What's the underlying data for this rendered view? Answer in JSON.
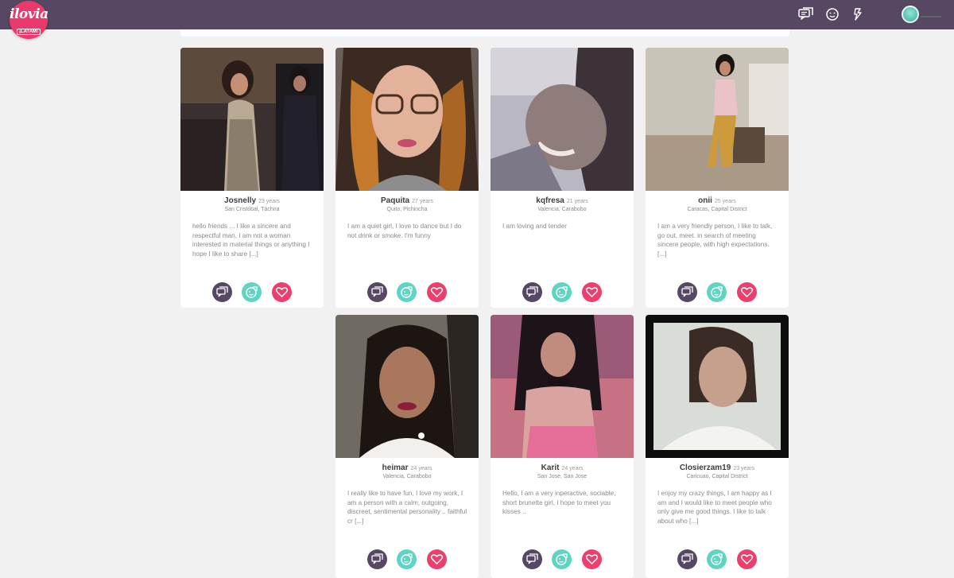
{
  "header": {
    "logo_text": "ilovia",
    "logo_tag": "¡LATAM!",
    "icons": [
      "messages-icon",
      "smiley-icon",
      "flash-icon"
    ]
  },
  "colors": {
    "header_bg": "#564863",
    "brand_pink": "#ea3a6d",
    "chat_button": "#564863",
    "wink_button": "#5fd4c1",
    "like_button": "#ec3f6e",
    "page_bg": "#f1f1f1"
  },
  "profiles": [
    {
      "name": "Josnelly",
      "age": "23 years",
      "location": "San Cristóbal, Táchira",
      "bio": "hello friends ... I like a sincere and respectful man, I am not a woman interested in material things or anything I hope I like to share [...]"
    },
    {
      "name": "Paquita",
      "age": "27 years",
      "location": "Quito, Pichincha",
      "bio": "I am a quiet girl, I love to dance but I do not drink or smoke. I'm funny"
    },
    {
      "name": "kqfresa",
      "age": "21 years",
      "location": "Valencia, Carabobo",
      "bio": "I am loving and tender"
    },
    {
      "name": "onii",
      "age": "25 years",
      "location": "Caracas, Capital District",
      "bio": "I am a very friendly person, I like to talk, go out, meet. in search of meeting sincere people, with high expectations. [...]"
    },
    {
      "name": "heimar",
      "age": "24 years",
      "location": "Valencia, Carabobo",
      "bio": "I really like to have fun, I love my work, I am a person with a calm, outgoing, discreet, sentimental personality .. faithful cr [...]"
    },
    {
      "name": "Karit",
      "age": "24 years",
      "location": "San Jose, San Jose",
      "bio": "Hello, I am a very inperactive, sociable, short brunette girl, I hope to meet you kisses .."
    },
    {
      "name": "Closierzam19",
      "age": "23 years",
      "location": "Caricuao, Capital District",
      "bio": "I enjoy my crazy things, I am happy as I am and I would like to meet people who only give me good things. I like to talk about who [...]"
    }
  ]
}
